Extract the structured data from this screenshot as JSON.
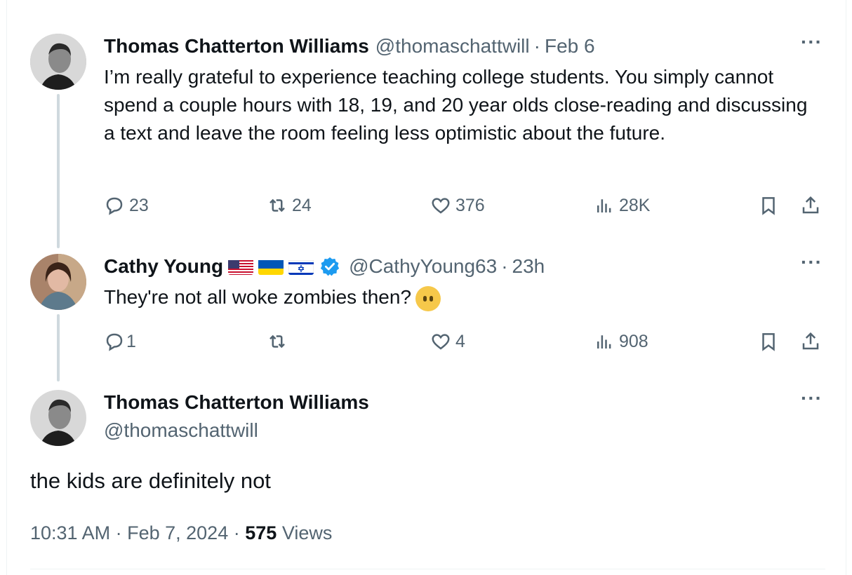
{
  "tweets": [
    {
      "author_name": "Thomas Chatterton Williams",
      "handle": "@thomaschattwill",
      "separator": "·",
      "time": "Feb 6",
      "text": "I’m really grateful to experience teaching college students. You simply cannot spend a couple hours with 18, 19, and 20 year olds close-reading and discussing a text and leave the room feeling less optimistic about the future.",
      "replies": "23",
      "reposts": "24",
      "likes": "376",
      "views": "28K"
    },
    {
      "author_name": "Cathy Young",
      "handle": "@CathyYoung63",
      "separator": "·",
      "time": "23h",
      "text": "They're not all woke zombies then?",
      "replies": "1",
      "reposts": "",
      "likes": "4",
      "views": "908"
    }
  ],
  "main_tweet": {
    "author_name": "Thomas Chatterton Williams",
    "handle": "@thomaschattwill",
    "text": "the kids are definitely not",
    "time": "10:31 AM",
    "date": "Feb 7, 2024",
    "separator": "·",
    "views_count": "575",
    "views_label": "Views"
  },
  "more_label": "···",
  "icons": [
    "reply-icon",
    "repost-icon",
    "like-icon",
    "views-icon",
    "bookmark-icon",
    "share-icon",
    "verified-badge-icon",
    "more-icon"
  ],
  "colors": {
    "text": "#0f1419",
    "secondary": "#536471",
    "verified": "#1d9bf0",
    "thread_line": "#cfd9de"
  }
}
